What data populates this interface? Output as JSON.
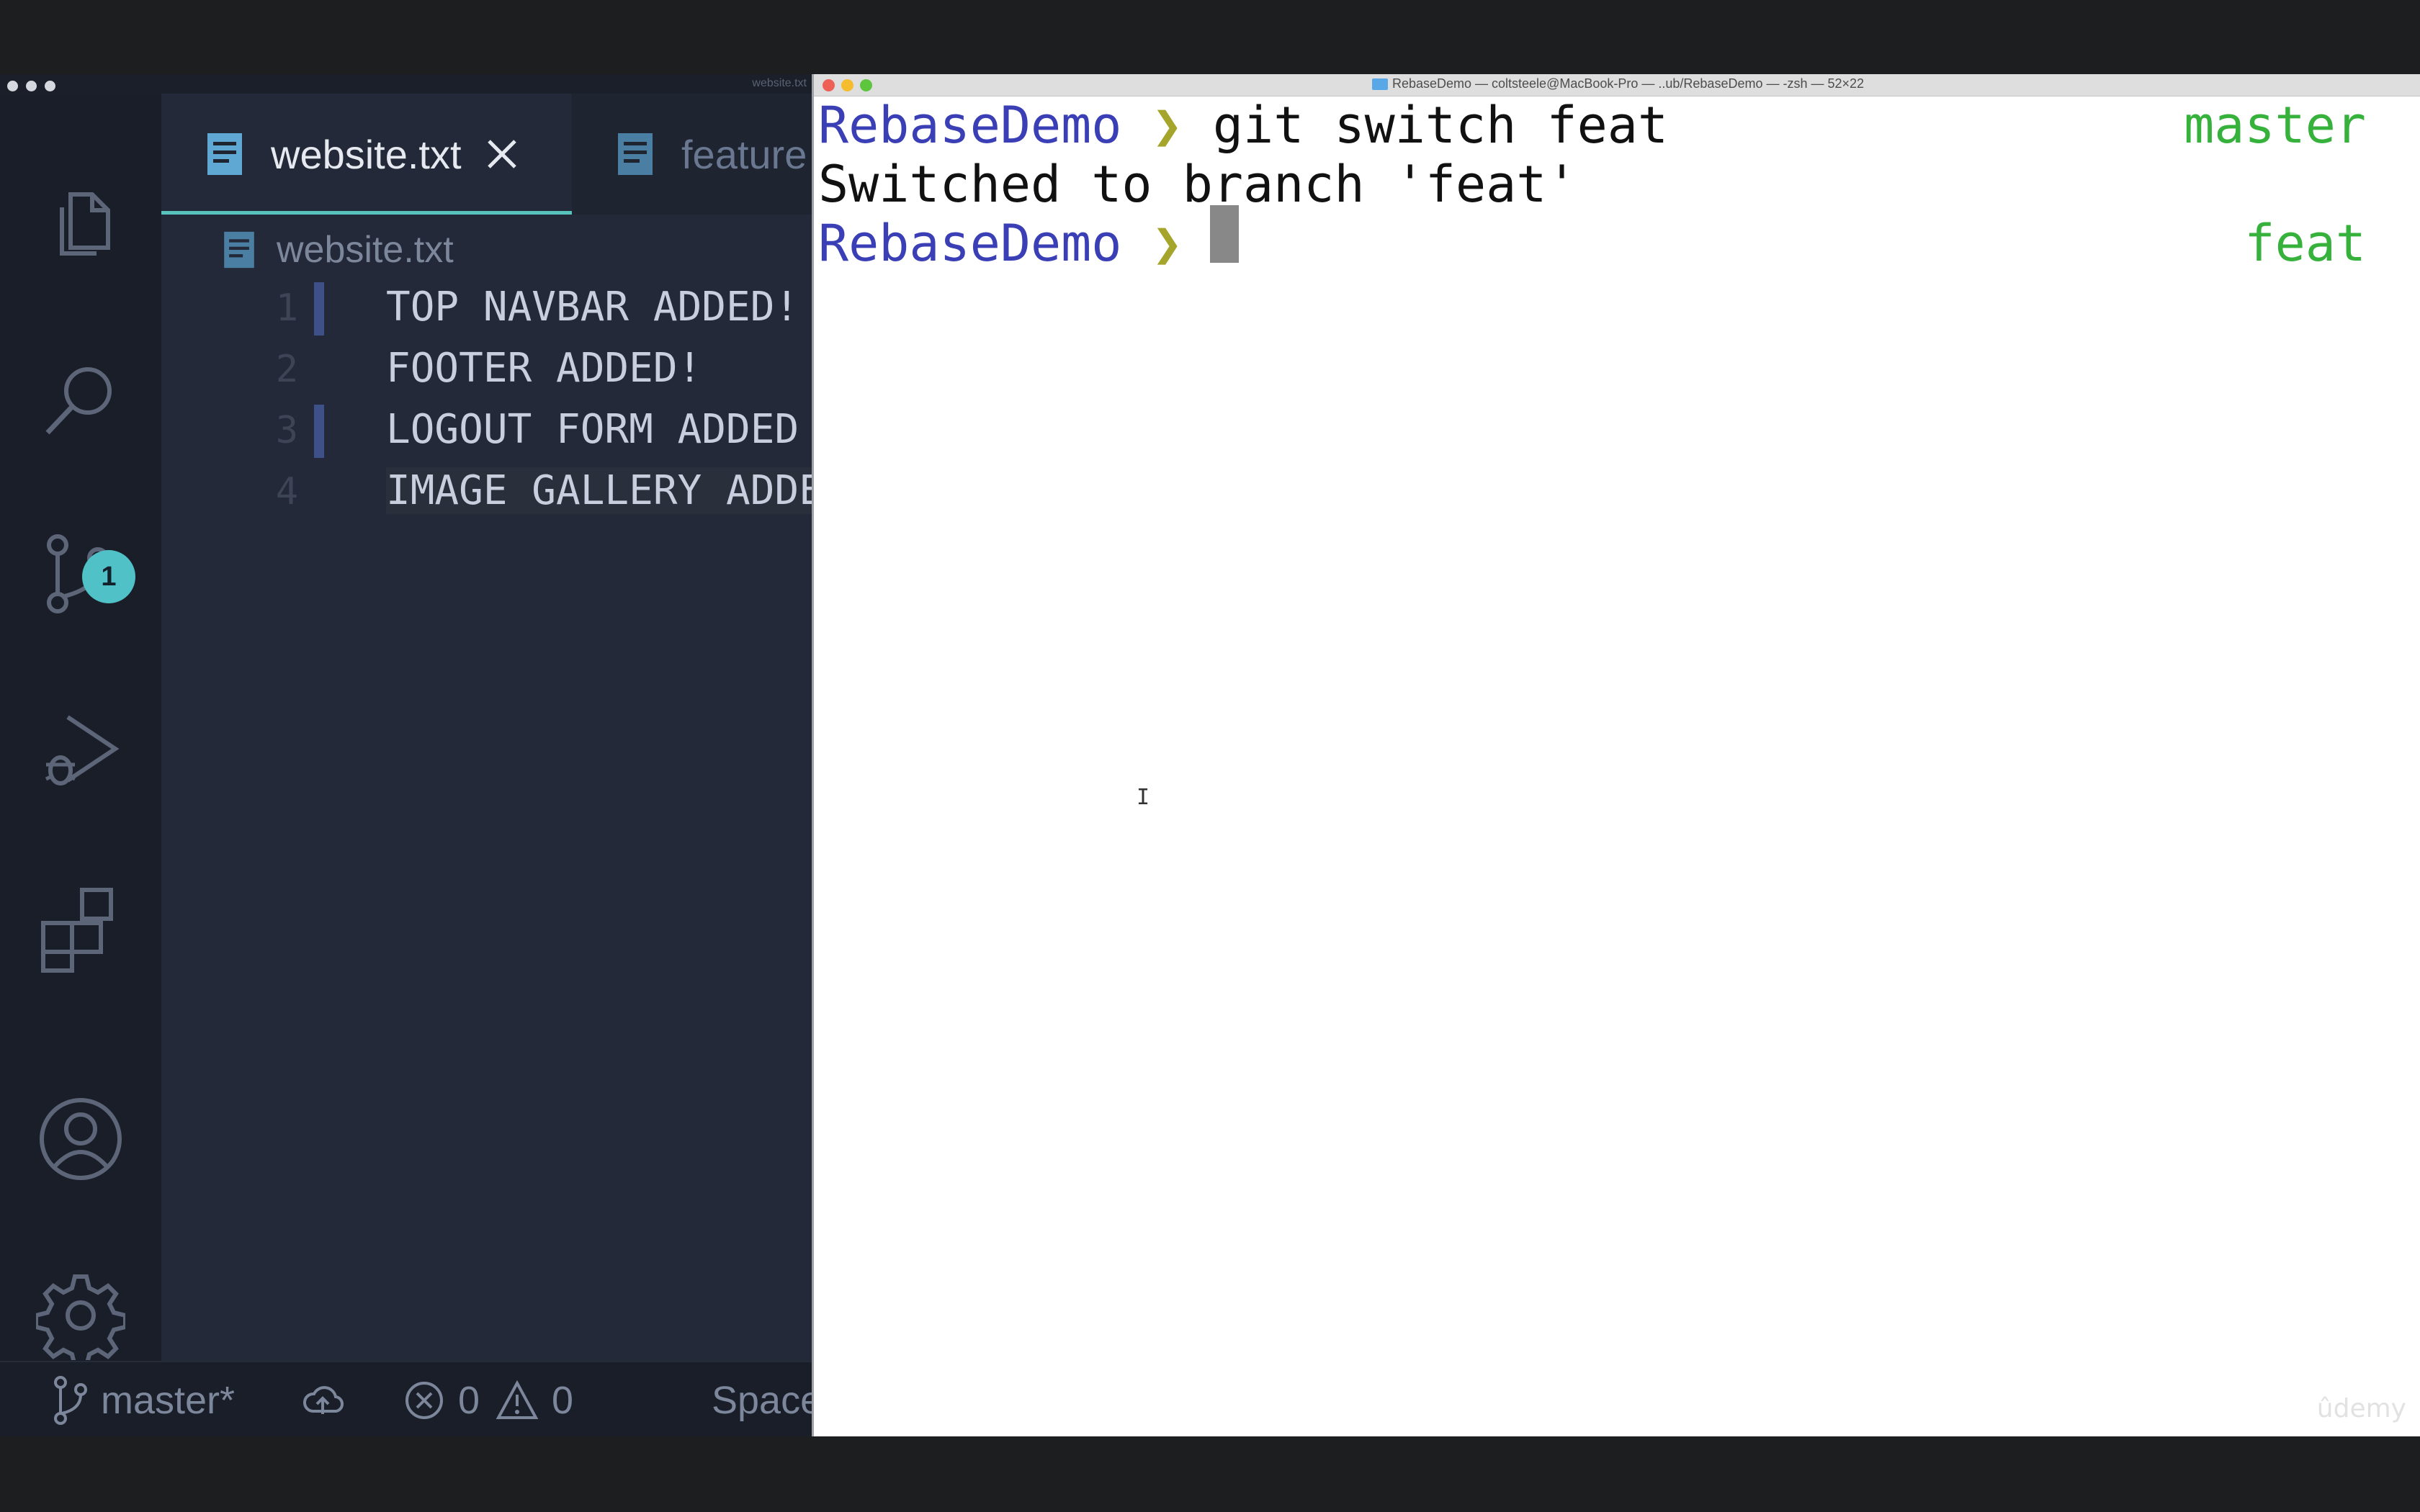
{
  "vscode": {
    "mini_title": "website.txt",
    "activity_bar": {
      "items": [
        {
          "name": "explorer",
          "icon": "files-icon"
        },
        {
          "name": "search",
          "icon": "search-icon"
        },
        {
          "name": "source-control",
          "icon": "source-control-icon",
          "badge": "1"
        },
        {
          "name": "run-and-debug",
          "icon": "debug-icon"
        },
        {
          "name": "extensions",
          "icon": "extensions-icon"
        },
        {
          "name": "accounts",
          "icon": "account-icon"
        },
        {
          "name": "manage",
          "icon": "gear-icon"
        }
      ]
    },
    "tabs": [
      {
        "label": "website.txt",
        "active": true
      },
      {
        "label": "feature",
        "active": false
      }
    ],
    "breadcrumb": "website.txt",
    "lines": [
      {
        "number": "1",
        "text": "TOP NAVBAR ADDED!"
      },
      {
        "number": "2",
        "text": "FOOTER ADDED!"
      },
      {
        "number": "3",
        "text": "LOGOUT FORM ADDED"
      },
      {
        "number": "4",
        "text": "IMAGE GALLERY ADDE"
      }
    ],
    "status_bar": {
      "branch": "master*",
      "errors": "0",
      "warnings": "0",
      "spaces": "Space"
    }
  },
  "terminal": {
    "title": "RebaseDemo — coltsteele@MacBook-Pro — ..ub/RebaseDemo — -zsh — 52×22",
    "lines": [
      {
        "prompt_dir": "RebaseDemo",
        "prompt_arrow": "❯",
        "command": "git switch feat",
        "branch": "master"
      },
      {
        "output": "Switched to branch 'feat'"
      },
      {
        "prompt_dir": "RebaseDemo",
        "prompt_arrow": "❯",
        "command": "",
        "branch": "feat"
      }
    ],
    "watermark": "ûdemy"
  },
  "colors": {
    "prompt_dir": "#3b3fb6",
    "prompt_arrow": "#a4a52a",
    "branch": "#36b23c",
    "badge": "#4fc1c7",
    "tab_underline": "#58c3bd"
  }
}
